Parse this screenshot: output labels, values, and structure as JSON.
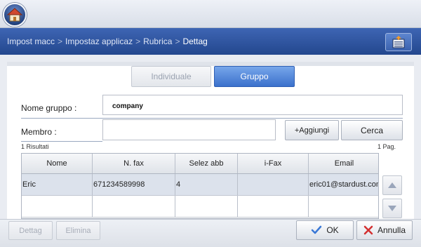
{
  "breadcrumb": {
    "items": [
      "Impost macc",
      "Impostaz applicaz",
      "Rubrica"
    ],
    "separator": ">",
    "current": "Dettag"
  },
  "tabs": {
    "individual": "Individuale",
    "group": "Gruppo"
  },
  "form": {
    "group_name_label": "Nome gruppo :",
    "group_name_value": "company",
    "member_label": "Membro :",
    "member_value": "",
    "add_button": "+Aggiungi",
    "search_button": "Cerca"
  },
  "results": {
    "count_text": "1 Risultati",
    "page_text": "1 Pag."
  },
  "table": {
    "columns": [
      "Nome",
      "N. fax",
      "Selez abb",
      "i-Fax",
      "Email"
    ],
    "rows": [
      [
        "Eric",
        "671234589998",
        "4",
        "",
        "eric01@stardust.com"
      ]
    ]
  },
  "footer": {
    "details_button": "Dettag",
    "delete_button": "Elimina",
    "ok_button": "OK",
    "cancel_button": "Annulla"
  },
  "colors": {
    "nav_blue": "#2f56a3",
    "selected_tab": "#4a80d6",
    "ok_check": "#3a78d6",
    "cancel_x": "#d33030"
  },
  "icons": {
    "home": "home-icon",
    "address_book": "address-book-icon",
    "scroll_up": "triangle-up-icon",
    "scroll_down": "triangle-down-icon",
    "ok": "checkmark-icon",
    "cancel": "x-icon"
  }
}
